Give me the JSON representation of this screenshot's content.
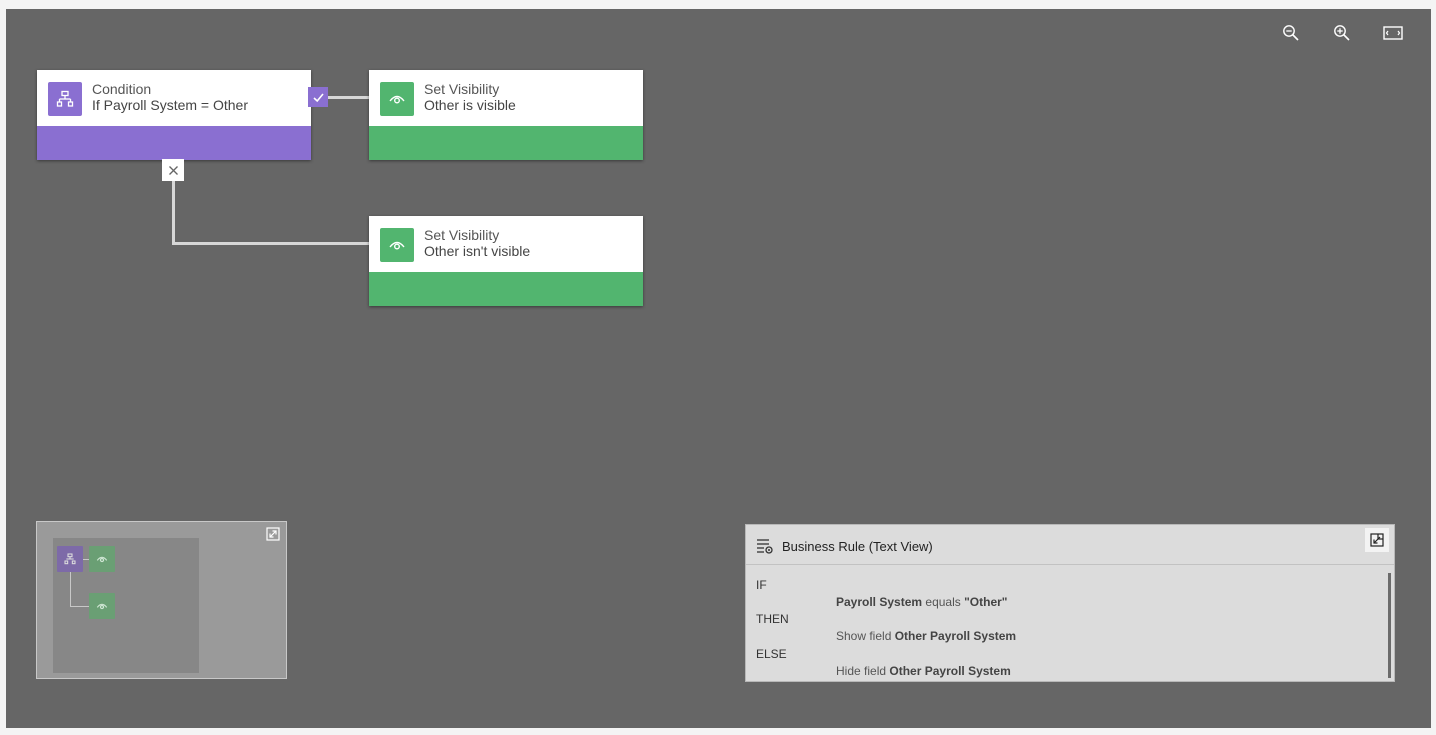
{
  "toolbar": {
    "zoom_out_icon": "zoom-out-icon",
    "zoom_in_icon": "zoom-in-icon",
    "fit_icon": "fit-to-screen-icon"
  },
  "nodes": {
    "condition": {
      "title": "Condition",
      "subtitle": "If Payroll System = Other",
      "icon": "condition-branch-icon",
      "color": "#8a6fd1"
    },
    "visible": {
      "title": "Set Visibility",
      "subtitle": "Other is visible",
      "icon": "eye-icon",
      "color": "#52b56f"
    },
    "not_visible": {
      "title": "Set Visibility",
      "subtitle": "Other isn't visible",
      "icon": "eye-icon",
      "color": "#52b56f"
    }
  },
  "badges": {
    "true_icon": "checkmark-icon",
    "false_icon": "close-icon"
  },
  "minimap": {
    "expand_icon": "expand-icon"
  },
  "text_view": {
    "title": "Business Rule (Text View)",
    "collapse_icon": "collapse-icon",
    "if_label": "IF",
    "if_field": "Payroll System",
    "if_operator": "equals",
    "if_value": "\"Other\"",
    "then_label": "THEN",
    "then_action": "Show field",
    "then_field": "Other Payroll System",
    "else_label": "ELSE",
    "else_action": "Hide field",
    "else_field": "Other Payroll System"
  }
}
